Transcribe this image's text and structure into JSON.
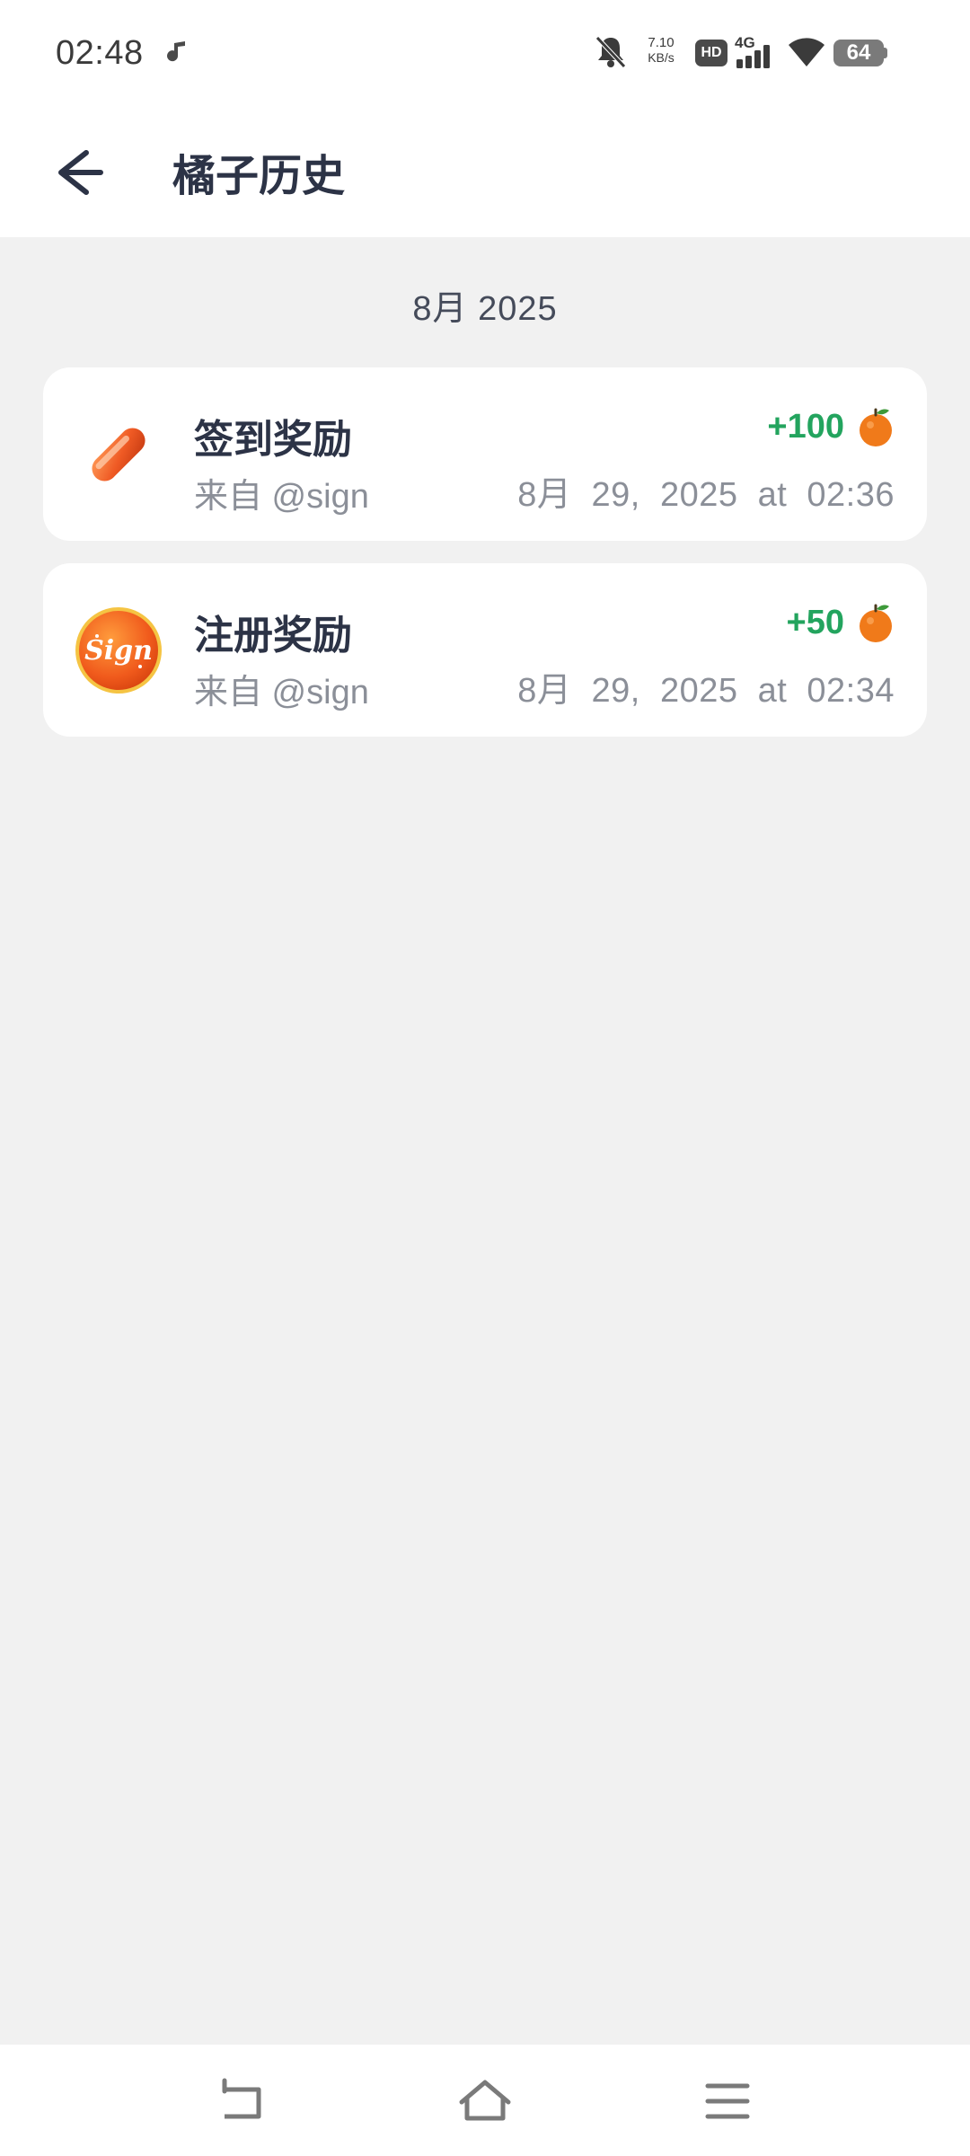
{
  "status_bar": {
    "time": "02:48",
    "net_speed_value": "7.10",
    "net_speed_unit": "KB/s",
    "hd_label": "HD",
    "network_type": "4G",
    "battery_level": "64",
    "icons": [
      "music-note-icon",
      "bell-off-icon",
      "signal-icon",
      "wifi-icon",
      "battery-icon"
    ]
  },
  "header": {
    "title": "橘子历史",
    "back_icon": "arrow-left-icon"
  },
  "month_section": {
    "label": "8月 2025"
  },
  "history": [
    {
      "title": "签到奖励",
      "source": "来自 @sign",
      "amount": "+100",
      "date": "8月  29,  2025  at  02:36",
      "avatar": "capsule-icon"
    },
    {
      "title": "注册奖励",
      "source": "来自 @sign",
      "amount": "+50",
      "date": "8月  29,  2025  at  02:34",
      "avatar": "sign-logo"
    }
  ],
  "colors": {
    "accent_green": "#23a45e",
    "title_dark": "#2c3346",
    "secondary_gray": "#8b8f98",
    "page_background": "#f1f1f1",
    "orange": "#f07a1a"
  },
  "nav_bar": {
    "icons": [
      "back-nav-icon",
      "home-icon",
      "menu-icon"
    ]
  }
}
